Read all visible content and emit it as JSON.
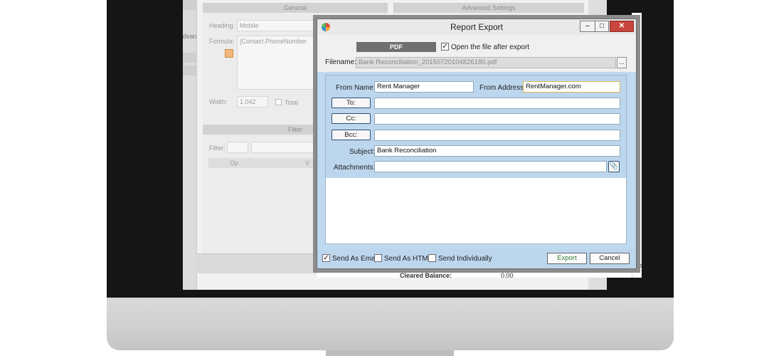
{
  "background": {
    "general_header": "General",
    "advanced_header": "Advanced Settings",
    "heading_label": "Heading:",
    "heading_value": "Mobile",
    "formula_label": "Formula:",
    "formula_value": "[Contact.PhoneNumber",
    "width_label": "Width:",
    "width_value": "1.042",
    "total_label": "Total",
    "filter_header": "Filter",
    "filter_label": "Filter:",
    "op_column": "Op",
    "v_column": "V",
    "left_fragment": "dvan",
    "right_fragment": "Va",
    "cleared_balance_label": "Cleared Balance:",
    "cleared_balance_value": "0.00"
  },
  "dialog": {
    "title": "Report Export",
    "pdf_tab": "PDF",
    "open_after_export_label": "Open the file after export",
    "open_after_export_checked": true,
    "filename_label": "Filename:",
    "filename_value": "Bank Reconciliation_20150720104826180.pdf",
    "browse_label": "...",
    "from_name_label": "From Name:",
    "from_name_value": "Rent Manager",
    "from_address_label": "From Address:",
    "from_address_value": "RentManager.com",
    "to_button": "To:",
    "cc_button": "Cc:",
    "bcc_button": "Bcc:",
    "subject_label": "Subject:",
    "subject_value": "Bank Reconciliation",
    "attachments_label": "Attachments:",
    "send_as_email_label": "Send As Email",
    "send_as_email_checked": true,
    "send_as_html_label": "Send As HTML",
    "send_individually_label": "Send Individually",
    "export_button": "Export",
    "cancel_button": "Cancel",
    "export_color": "#2e7d32"
  }
}
